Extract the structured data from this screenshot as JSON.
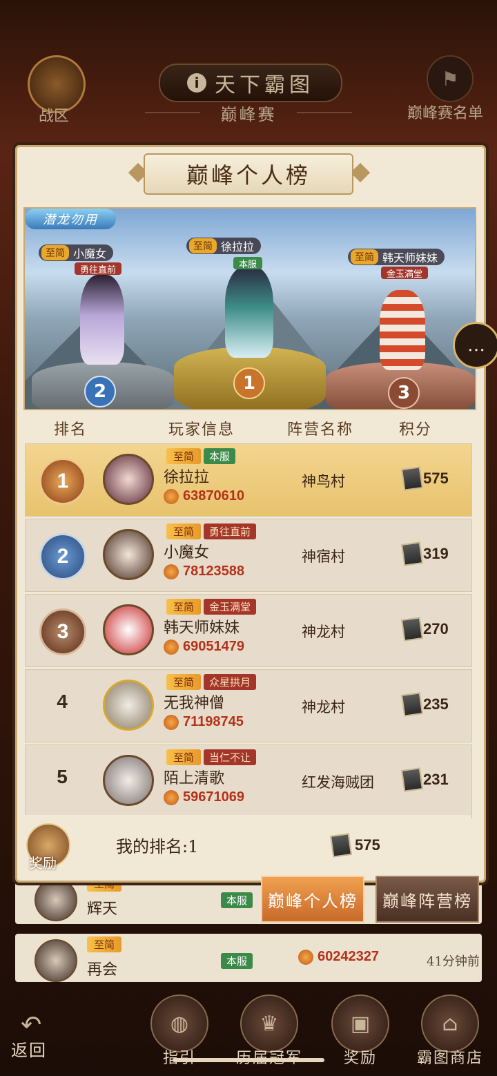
{
  "header": {
    "title": "天下霸图",
    "subtitle": "巅峰赛",
    "war_zone_label": "战区",
    "peak_list_label": "巅峰赛名单"
  },
  "modal": {
    "title": "巅峰个人榜",
    "podium": {
      "brand_tag": "潜龙勿用",
      "first": {
        "rank": "1",
        "tier": "至简",
        "name": "徐拉拉",
        "camp_tag": "本服"
      },
      "second": {
        "rank": "2",
        "tier": "至简",
        "name": "小魔女",
        "camp_tag": "勇往直前"
      },
      "third": {
        "rank": "3",
        "tier": "至简",
        "name": "韩天师妹妹",
        "camp_tag": "金玉满堂"
      }
    },
    "columns": {
      "rank": "排名",
      "player": "玩家信息",
      "camp": "阵营名称",
      "score": "积分"
    },
    "rows": [
      {
        "rank": "1",
        "tier": "至简",
        "tag": "本服",
        "name": "徐拉拉",
        "power": "63870610",
        "camp": "神鸟村",
        "score": "575"
      },
      {
        "rank": "2",
        "tier": "至简",
        "tag": "勇往直前",
        "name": "小魔女",
        "power": "78123588",
        "camp": "神宿村",
        "score": "319"
      },
      {
        "rank": "3",
        "tier": "至简",
        "tag": "金玉满堂",
        "name": "韩天师妹妹",
        "power": "69051479",
        "camp": "神龙村",
        "score": "270"
      },
      {
        "rank": "4",
        "tier": "至简",
        "tag": "众星拱月",
        "name": "无我神僧",
        "power": "71198745",
        "camp": "神龙村",
        "score": "235"
      },
      {
        "rank": "5",
        "tier": "至简",
        "tag": "当仁不让",
        "name": "陌上清歌",
        "power": "59671069",
        "camp": "红发海贼团",
        "score": "231"
      }
    ],
    "my_rank": {
      "reward_label": "奖励",
      "text": "我的排名:1",
      "score": "575"
    },
    "tabs": {
      "personal": "巅峰个人榜",
      "camp": "巅峰阵营榜"
    }
  },
  "background_list": [
    {
      "tier": "至简",
      "name": "辉天",
      "tag": "本服"
    },
    {
      "tier": "至简",
      "name": "再会",
      "tag": "本服",
      "power": "60242327",
      "time": "41分钟前"
    }
  ],
  "bottom_nav": {
    "back": "返回",
    "guide": "指引",
    "champions": "历届冠军",
    "reward": "奖励",
    "shop": "霸图商店"
  },
  "icons": [
    "info-icon",
    "chat-icon",
    "back-arrow-icon",
    "score-token-icon",
    "power-flame-icon",
    "treasure-box-icon",
    "flag-icon"
  ],
  "colors": {
    "gold_row": "#e8c36e",
    "power_red": "#b5321a",
    "tier_orange": "#e89a2a",
    "tab_active": "#c86a2a"
  }
}
